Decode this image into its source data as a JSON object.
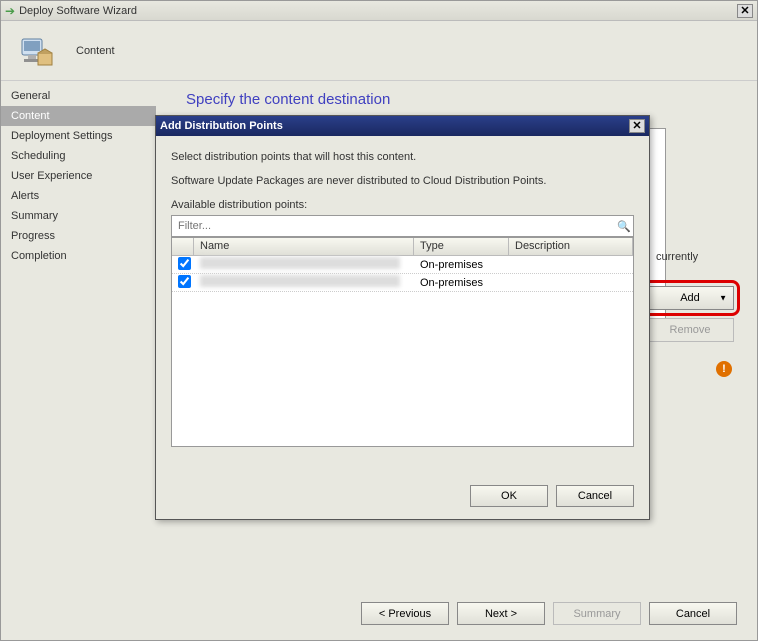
{
  "wizard": {
    "title": "Deploy Software Wizard",
    "step_title": "Content",
    "section_heading": "Specify the content destination",
    "currently_label": "currently",
    "add_label": "Add",
    "remove_label": "Remove",
    "footer": {
      "previous": "< Previous",
      "next": "Next >",
      "summary": "Summary",
      "cancel": "Cancel"
    }
  },
  "sidebar": {
    "items": [
      {
        "label": "General"
      },
      {
        "label": "Content"
      },
      {
        "label": "Deployment Settings"
      },
      {
        "label": "Scheduling"
      },
      {
        "label": "User Experience"
      },
      {
        "label": "Alerts"
      },
      {
        "label": "Summary"
      },
      {
        "label": "Progress"
      },
      {
        "label": "Completion"
      }
    ],
    "active_index": 1
  },
  "dialog": {
    "title": "Add Distribution Points",
    "instruction": "Select distribution points that will host this content.",
    "note": "Software Update Packages are never distributed to Cloud Distribution Points.",
    "available_label": "Available distribution points:",
    "filter_placeholder": "Filter...",
    "columns": {
      "name": "Name",
      "type": "Type",
      "description": "Description"
    },
    "rows": [
      {
        "checked": true,
        "name": "(redacted)",
        "type": "On-premises",
        "description": ""
      },
      {
        "checked": true,
        "name": "(redacted)",
        "type": "On-premises",
        "description": ""
      }
    ],
    "ok": "OK",
    "cancel": "Cancel"
  }
}
